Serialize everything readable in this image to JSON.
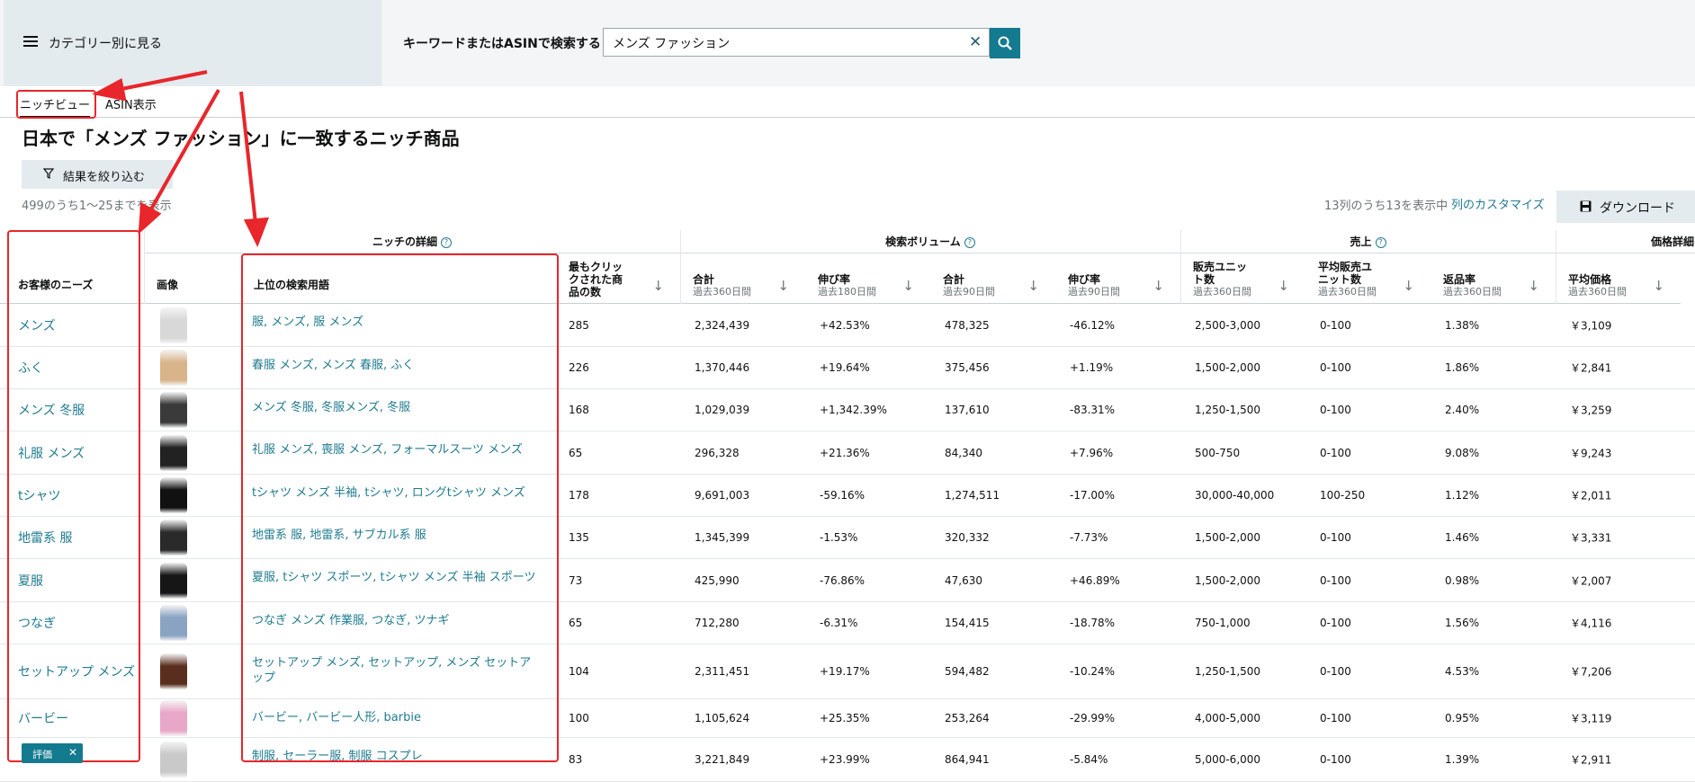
{
  "topbar": {
    "category_label": "カテゴリー別に見る",
    "search_label": "キーワードまたはASINで検索する",
    "search_value": "メンズ ファッション"
  },
  "tabs": [
    {
      "label": "ニッチビュー",
      "active": true
    },
    {
      "label": "ASIN表示",
      "active": false
    }
  ],
  "page_title": "日本で「メンズ ファッション」に一致するニッチ商品",
  "filter_label": "結果を絞り込む",
  "count_text": "499のうち1〜25までを表示",
  "columns_text": "13列のうち13を表示中",
  "customize_label": "列のカスタマイズ",
  "download_label": "ダウンロード",
  "groups": {
    "niche": "ニッチの詳細",
    "search": "検索ボリューム",
    "sales": "売上",
    "price": "価格詳細"
  },
  "columns": {
    "needs": "お客様のニーズ",
    "image": "画像",
    "terms": "上位の検索用語",
    "clicked_l1": "最もクリッ",
    "clicked_l2": "クされた商",
    "clicked_l3": "品の数",
    "sv_total": "合計",
    "sv_total_sub": "過去360日間",
    "sv_growth": "伸び率",
    "sv_growth_sub": "過去180日間",
    "sv_total90": "合計",
    "sv_total90_sub": "過去90日間",
    "sv_growth90": "伸び率",
    "sv_growth90_sub": "過去90日間",
    "units_l1": "販売ユニッ",
    "units_l2": "ト数",
    "units_sub": "過去360日間",
    "avg_units_l1": "平均販売ユ",
    "avg_units_l2": "ニット数",
    "avg_units_sub": "過去360日間",
    "return": "返品率",
    "return_sub": "過去360日間",
    "avg_price": "平均価格",
    "avg_price_sub": "過去360日間"
  },
  "rows": [
    {
      "need": "メンズ",
      "terms": "服, メンズ, 服 メンズ",
      "clicked": "285",
      "sv360": "2,324,439",
      "g180": "+42.53%",
      "sv90": "478,325",
      "g90": "-46.12%",
      "units": "2,500-3,000",
      "avg_units": "0-100",
      "ret": "1.38%",
      "price": "￥3,109"
    },
    {
      "need": "ふく",
      "terms": "春服 メンズ, メンズ 春服, ふく",
      "clicked": "226",
      "sv360": "1,370,446",
      "g180": "+19.64%",
      "sv90": "375,456",
      "g90": "+1.19%",
      "units": "1,500-2,000",
      "avg_units": "0-100",
      "ret": "1.86%",
      "price": "￥2,841"
    },
    {
      "need": "メンズ 冬服",
      "terms": "メンズ 冬服, 冬服メンズ, 冬服",
      "clicked": "168",
      "sv360": "1,029,039",
      "g180": "+1,342.39%",
      "sv90": "137,610",
      "g90": "-83.31%",
      "units": "1,250-1,500",
      "avg_units": "0-100",
      "ret": "2.40%",
      "price": "￥3,259"
    },
    {
      "need": "礼服 メンズ",
      "terms": "礼服 メンズ, 喪服 メンズ, フォーマルスーツ メンズ",
      "clicked": "65",
      "sv360": "296,328",
      "g180": "+21.36%",
      "sv90": "84,340",
      "g90": "+7.96%",
      "units": "500-750",
      "avg_units": "0-100",
      "ret": "9.08%",
      "price": "￥9,243"
    },
    {
      "need": "tシャツ",
      "terms": "tシャツ メンズ 半袖, tシャツ, ロングtシャツ メンズ",
      "clicked": "178",
      "sv360": "9,691,003",
      "g180": "-59.16%",
      "sv90": "1,274,511",
      "g90": "-17.00%",
      "units": "30,000-40,000",
      "avg_units": "100-250",
      "ret": "1.12%",
      "price": "￥2,011"
    },
    {
      "need": "地雷系 服",
      "terms": "地雷系 服, 地雷系, サブカル系 服",
      "clicked": "135",
      "sv360": "1,345,399",
      "g180": "-1.53%",
      "sv90": "320,332",
      "g90": "-7.73%",
      "units": "1,500-2,000",
      "avg_units": "0-100",
      "ret": "1.46%",
      "price": "￥3,331"
    },
    {
      "need": "夏服",
      "terms": "夏服, tシャツ スポーツ, tシャツ メンズ 半袖 スポーツ",
      "clicked": "73",
      "sv360": "425,990",
      "g180": "-76.86%",
      "sv90": "47,630",
      "g90": "+46.89%",
      "units": "1,500-2,000",
      "avg_units": "0-100",
      "ret": "0.98%",
      "price": "￥2,007"
    },
    {
      "need": "つなぎ",
      "terms": "つなぎ メンズ 作業服, つなぎ, ツナギ",
      "clicked": "65",
      "sv360": "712,280",
      "g180": "-6.31%",
      "sv90": "154,415",
      "g90": "-18.78%",
      "units": "750-1,000",
      "avg_units": "0-100",
      "ret": "1.56%",
      "price": "￥4,116"
    },
    {
      "need": "セットアップ メンズ",
      "terms": "セットアップ メンズ, セットアップ, メンズ セットアップ",
      "clicked": "104",
      "sv360": "2,311,451",
      "g180": "+19.17%",
      "sv90": "594,482",
      "g90": "-10.24%",
      "units": "1,250-1,500",
      "avg_units": "0-100",
      "ret": "4.53%",
      "price": "￥7,206"
    },
    {
      "need": "バービー",
      "terms": "バービー, バービー人形, barbie",
      "clicked": "100",
      "sv360": "1,105,624",
      "g180": "+25.35%",
      "sv90": "253,264",
      "g90": "-29.99%",
      "units": "4,000-5,000",
      "avg_units": "0-100",
      "ret": "0.95%",
      "price": "￥3,119"
    },
    {
      "need": "",
      "terms": "制服, セーラー服, 制服 コスプレ",
      "clicked": "83",
      "sv360": "3,221,849",
      "g180": "+23.99%",
      "sv90": "864,941",
      "g90": "-5.84%",
      "units": "5,000-6,000",
      "avg_units": "0-100",
      "ret": "1.39%",
      "price": "￥2,911"
    }
  ],
  "badge_label": "評価",
  "colors": {
    "accent": "#147a8f",
    "link": "#1f7b8f",
    "annotation": "#e8262b"
  }
}
